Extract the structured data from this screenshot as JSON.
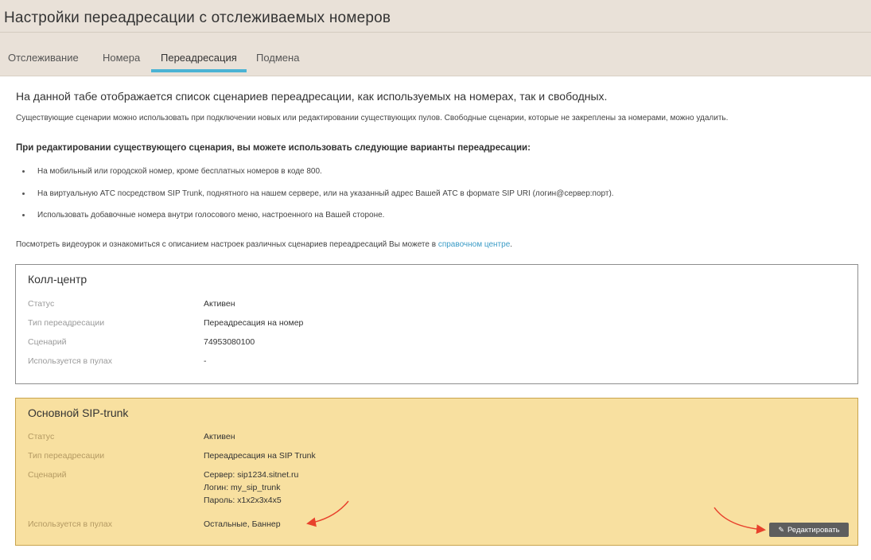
{
  "header": {
    "title": "Настройки переадресации с отслеживаемых номеров",
    "tabs": [
      {
        "label": "Отслеживание",
        "active": false
      },
      {
        "label": "Номера",
        "active": false
      },
      {
        "label": "Переадресация",
        "active": true
      },
      {
        "label": "Подмена",
        "active": false
      }
    ]
  },
  "intro": {
    "title": "На данной табе отображается список сценариев переадресации, как используемых на номерах, так и свободных.",
    "subtitle": "Существующие сценарии можно использовать при подключении новых или редактировании существующих пулов. Свободные сценарии, которые не закреплены за номерами, можно удалить.",
    "bold_line": "При редактировании существующего сценария, вы можете использовать следующие варианты переадресации:",
    "bullets": [
      "На мобильный или городской номер, кроме бесплатных номеров в коде 800.",
      "На виртуальную АТС посредством SIP Trunk, поднятного на нашем сервере, или на указанный адрес Вашей АТС в формате SIP URI (логин@сервер:порт).",
      "Использовать добавочные номера внутри голосового меню, настроенного на Вашей стороне."
    ],
    "help_text": "Посмотреть видеоурок и ознакомиться с описанием настроек различных сценариев переадресаций Вы можете в ",
    "help_link": "справочном центре",
    "help_tail": "."
  },
  "cards": [
    {
      "title": "Колл-центр",
      "labels": {
        "status": "Статус",
        "type": "Тип переадресации",
        "scenario": "Сценарий",
        "pools": "Используется в пулах"
      },
      "status": "Активен",
      "type": "Переадресация на номер",
      "scenario": [
        "74953080100"
      ],
      "pools": "-"
    },
    {
      "title": "Основной SIP-trunk",
      "labels": {
        "status": "Статус",
        "type": "Тип переадресации",
        "scenario": "Сценарий",
        "pools": "Используется в пулах"
      },
      "status": "Активен",
      "type": "Переадресация на SIP Trunk",
      "scenario": [
        "Сервер: sip1234.sitnet.ru",
        "Логин: my_sip_trunk",
        "Пароль: x1x2x3x4x5"
      ],
      "pools": "Остальные, Баннер",
      "edit_label": "Редактировать"
    }
  ],
  "colors": {
    "header_bg": "#e9e1d8",
    "tab_accent": "#4bb3d4",
    "highlight_bg": "#f8e0a0",
    "link": "#3a9bc6",
    "arrow": "#e8412c",
    "button_bg": "#5e5e5e"
  },
  "icons": {
    "edit": "pencil-icon"
  }
}
